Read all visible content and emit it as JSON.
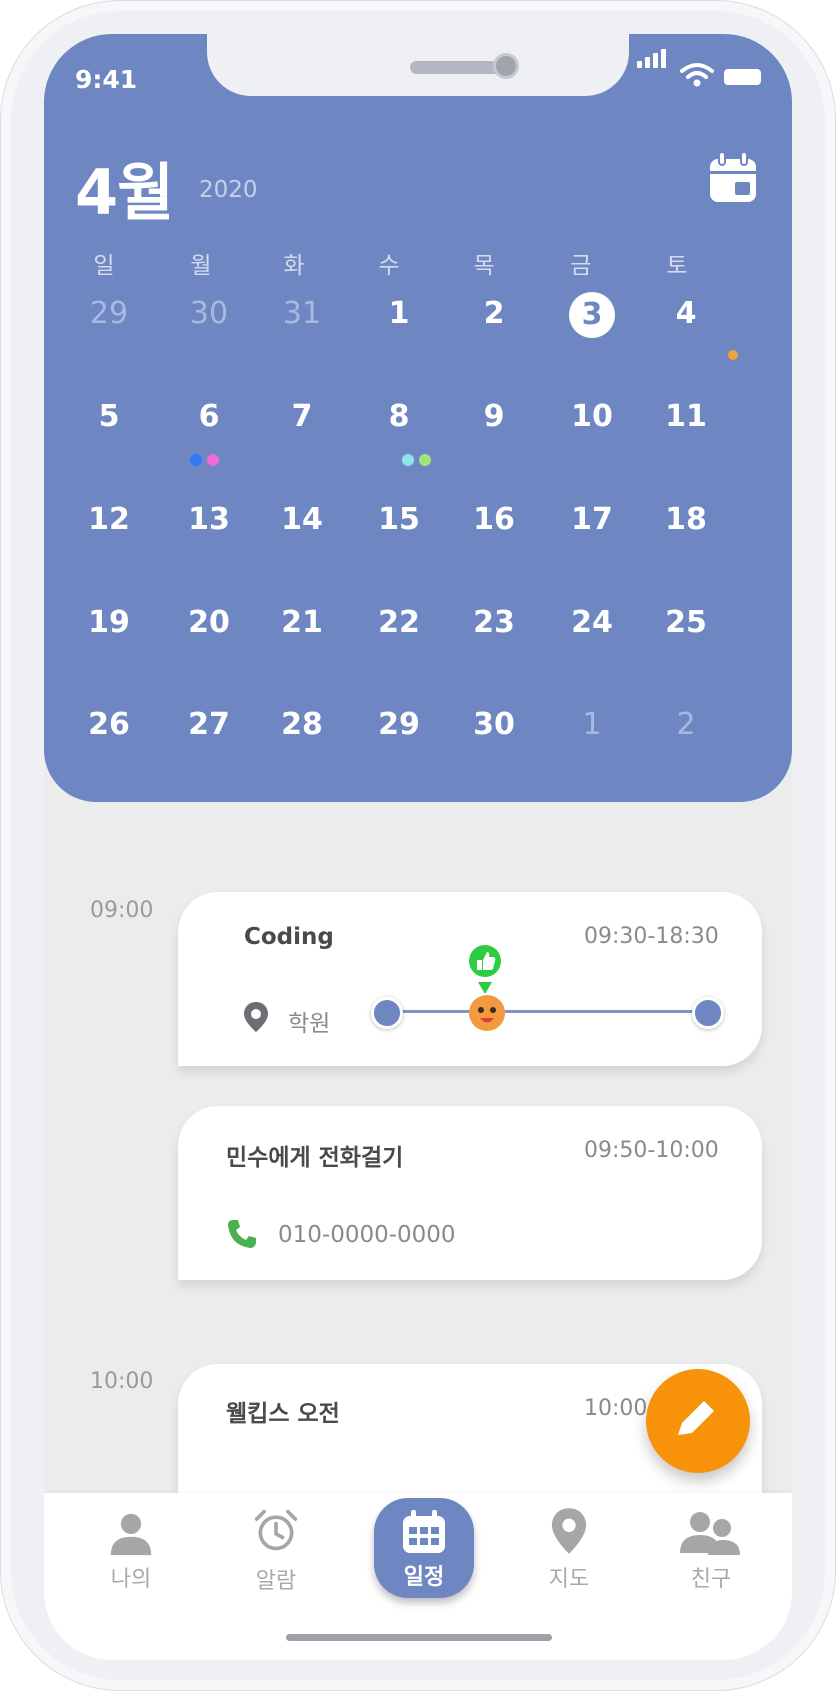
{
  "status": {
    "time": "9:41"
  },
  "calendar": {
    "month": "4월",
    "year": "2020",
    "weekdays": [
      "일",
      "월",
      "화",
      "수",
      "목",
      "금",
      "토"
    ],
    "weeks": [
      [
        "29",
        "30",
        "31",
        "1",
        "2",
        "3",
        "4"
      ],
      [
        "5",
        "6",
        "7",
        "8",
        "9",
        "10",
        "11"
      ],
      [
        "12",
        "13",
        "14",
        "15",
        "16",
        "17",
        "18"
      ],
      [
        "19",
        "20",
        "21",
        "22",
        "23",
        "24",
        "25"
      ],
      [
        "26",
        "27",
        "28",
        "29",
        "30",
        "1",
        "2"
      ]
    ],
    "today": "3",
    "event_dot_colors": {
      "apr4": [
        "#f0a040"
      ],
      "apr6": [
        "#2f7af0",
        "#f06ad8"
      ],
      "apr8": [
        "#8ce6e8",
        "#9ee67a"
      ]
    }
  },
  "schedule": {
    "slots": [
      "09:00",
      "10:00"
    ],
    "events": [
      {
        "title": "Coding",
        "time": "09:30-18:30",
        "location": "학원",
        "progress_fraction": 0.31
      },
      {
        "title": "민수에게 전화걸기",
        "time": "09:50-10:00",
        "phone": "010-0000-0000"
      },
      {
        "title": "웰킵스 오전",
        "time": "10:00"
      }
    ]
  },
  "tabs": [
    {
      "label": "나의",
      "icon": "person-icon"
    },
    {
      "label": "알람",
      "icon": "alarm-clock-icon"
    },
    {
      "label": "일정",
      "icon": "calendar-icon",
      "active": true
    },
    {
      "label": "지도",
      "icon": "map-pin-icon"
    },
    {
      "label": "친구",
      "icon": "friends-icon"
    }
  ],
  "colors": {
    "header": "#6e87c2",
    "fab": "#f8920b",
    "phone_icon": "#4caf50",
    "progress_marker": "#2ecc40"
  }
}
